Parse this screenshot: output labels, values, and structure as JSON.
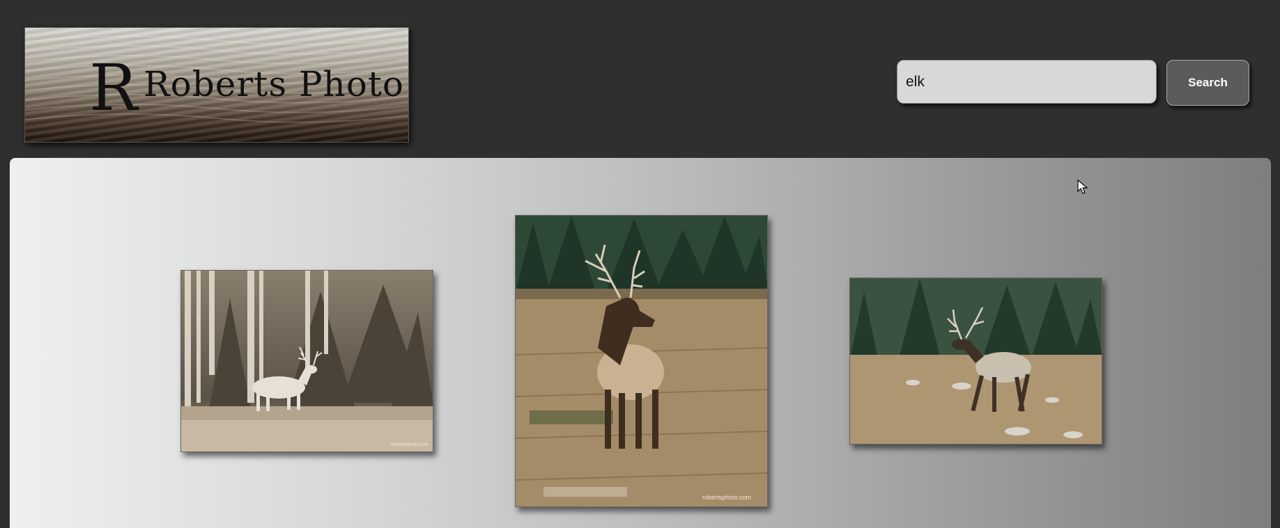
{
  "header": {
    "logo": {
      "initial": "R",
      "text": "Roberts Photo"
    },
    "search": {
      "value": "elk",
      "button_label": "Search"
    }
  },
  "gallery": {
    "photos": [
      {
        "subject": "elk in aspen forest",
        "watermark": "robertsphoto.com"
      },
      {
        "subject": "bull elk in meadow",
        "watermark": "robertsphoto.com"
      },
      {
        "subject": "bull elk walking",
        "watermark": ""
      }
    ]
  },
  "colors": {
    "background": "#2f2f2f",
    "button": "#5b5b5b",
    "input": "#d7d9d7"
  }
}
